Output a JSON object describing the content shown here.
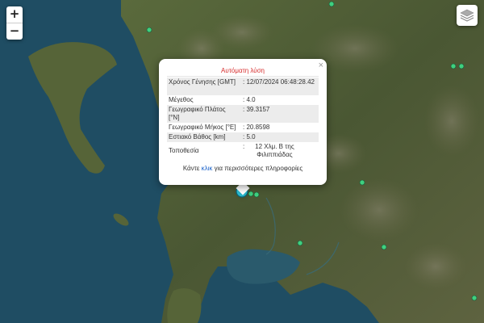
{
  "map": {
    "zoom_in_label": "+",
    "zoom_out_label": "−",
    "layers_icon": "layers-stack-icon",
    "colors": {
      "sea": "#1f4d63",
      "land": "#4d5a35",
      "marker": "#2fd1e8",
      "small_marker": "#3fd07f"
    }
  },
  "popup": {
    "title": "Αυτόματη λύση",
    "close_label": "×",
    "rows": [
      {
        "label": "Χρόνος Γένησης [GMT]",
        "value": "12/07/2024 06:48:28.42"
      },
      {
        "label": "Μέγεθος",
        "value": "4.0"
      },
      {
        "label": "Γεωγραφικό Πλάτος [°N]",
        "value": "39.3157"
      },
      {
        "label": "Γεωγραφικό Μήκος [°E]",
        "value": "20.8598"
      },
      {
        "label": "Εστιακό Βάθος [km]",
        "value": "5.0"
      },
      {
        "label": "Τοποθεσία",
        "value": "12 Χλμ. Β της Φιλιππιάδας"
      }
    ],
    "more_prefix": "Κάντε",
    "more_link": "κλικ",
    "more_suffix": "για περισσότερες πληροφορίες"
  }
}
